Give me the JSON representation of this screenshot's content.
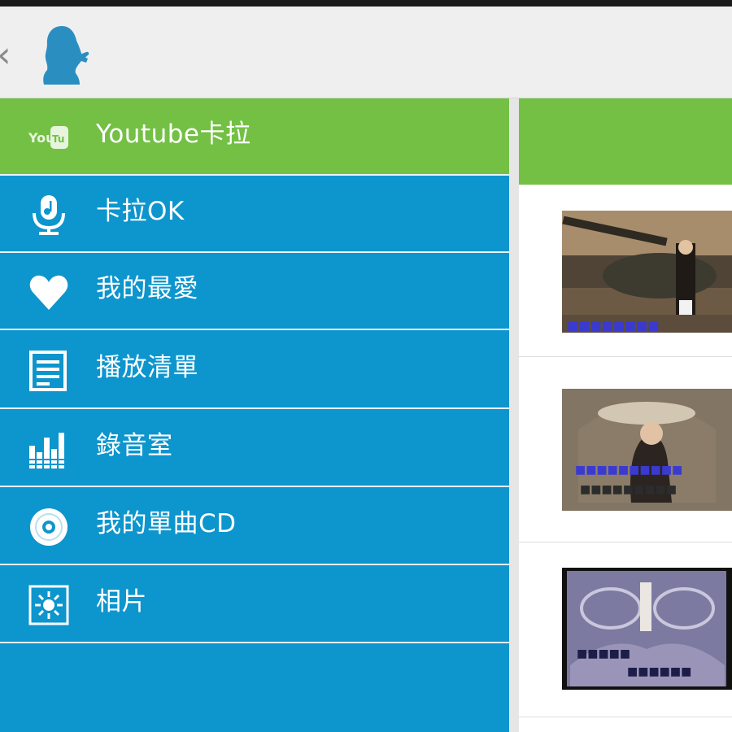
{
  "action_bar": {
    "back_icon": "chevron-left-icon",
    "back_glyph": "‹",
    "logo_icon": "singer-silhouette-icon"
  },
  "menu": {
    "items": [
      {
        "label": "Youtube卡拉",
        "icon": "youtube-icon",
        "active": true
      },
      {
        "label": "卡拉OK",
        "icon": "microphone-music-icon",
        "active": false
      },
      {
        "label": "我的最愛",
        "icon": "heart-icon",
        "active": false
      },
      {
        "label": "播放清單",
        "icon": "list-document-icon",
        "active": false
      },
      {
        "label": "錄音室",
        "icon": "equalizer-icon",
        "active": false
      },
      {
        "label": "我的單曲CD",
        "icon": "cd-icon",
        "active": false
      },
      {
        "label": "相片",
        "icon": "photo-sun-icon",
        "active": false
      }
    ]
  },
  "videos": [
    {
      "thumbnail": "karaoke-video-thumbnail-tank"
    },
    {
      "thumbnail": "karaoke-video-thumbnail-fountain"
    },
    {
      "thumbnail": "karaoke-video-thumbnail-stage"
    }
  ],
  "colors": {
    "drawer_blue": "#0d95cd",
    "active_green": "#73c045",
    "action_bar": "#efefef",
    "logo_blue": "#2a8fc0"
  }
}
